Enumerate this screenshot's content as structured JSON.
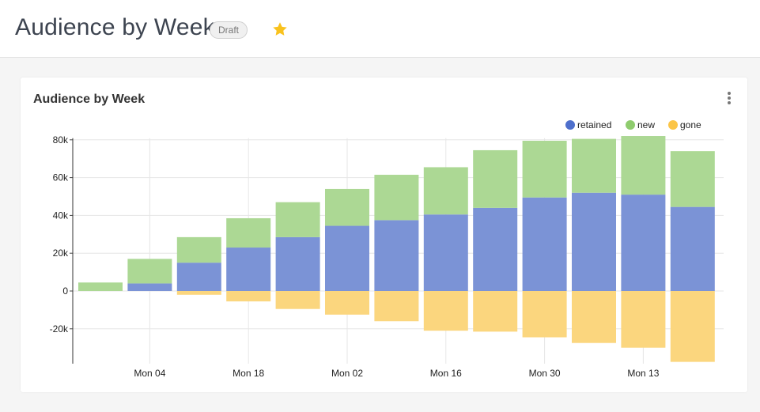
{
  "header": {
    "title": "Audience by Week",
    "status_badge": "Draft",
    "favorite_icon": "star-icon",
    "favorite_color": "#f9c21d"
  },
  "card": {
    "title": "Audience by Week",
    "menu_icon": "more-vertical-icon"
  },
  "chart_data": {
    "type": "bar",
    "stacked": true,
    "title": "Audience by Week",
    "xlabel": "",
    "ylabel": "",
    "ylim": [
      -38000,
      80000
    ],
    "y_ticks": [
      -20000,
      0,
      20000,
      40000,
      60000,
      80000
    ],
    "y_tick_labels": [
      "-20k",
      "0",
      "20k",
      "40k",
      "60k",
      "80k"
    ],
    "x_tick_labels": [
      {
        "label": "Mon 04",
        "at": 1.5
      },
      {
        "label": "Mon 18",
        "at": 3.5
      },
      {
        "label": "Mon 02",
        "at": 5.5
      },
      {
        "label": "Mon 16",
        "at": 7.5
      },
      {
        "label": "Mon 30",
        "at": 9.5
      },
      {
        "label": "Mon 13",
        "at": 11.5
      }
    ],
    "grid": true,
    "legend_position": "top-right",
    "bar_count": 13,
    "series": [
      {
        "name": "retained",
        "color": "#7b93d6",
        "legend_color": "#4e6fcc",
        "values": [
          0,
          4000,
          15000,
          23000,
          28500,
          34500,
          37500,
          40500,
          44000,
          49500,
          52000,
          51000,
          44500
        ]
      },
      {
        "name": "new",
        "color": "#acd894",
        "legend_color": "#8fcc6e",
        "values": [
          4500,
          13000,
          13500,
          15500,
          18500,
          19500,
          24000,
          25000,
          30500,
          30000,
          28500,
          31000,
          29500
        ]
      },
      {
        "name": "gone",
        "color": "#fbd67e",
        "legend_color": "#fbc547",
        "values": [
          0,
          0,
          -2000,
          -5500,
          -9500,
          -12500,
          -16000,
          -21000,
          -21500,
          -24500,
          -27500,
          -30000,
          -37500
        ]
      }
    ]
  }
}
